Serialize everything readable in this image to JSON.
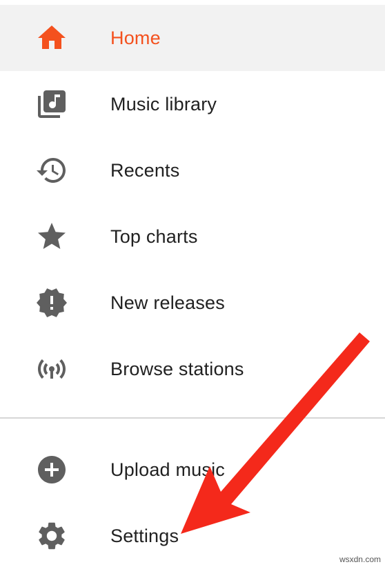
{
  "colors": {
    "accent": "#f4511e",
    "icon": "#5f5f5f",
    "text": "#212121",
    "active_background": "#f2f2f2",
    "annotation_arrow": "#f4291b"
  },
  "nav": {
    "items": [
      {
        "label": "Home",
        "icon": "home-icon",
        "active": true
      },
      {
        "label": "Music library",
        "icon": "music-library-icon"
      },
      {
        "label": "Recents",
        "icon": "recents-history-icon"
      },
      {
        "label": "Top charts",
        "icon": "star-icon"
      },
      {
        "label": "New releases",
        "icon": "new-releases-icon"
      },
      {
        "label": "Browse stations",
        "icon": "radio-stations-icon"
      }
    ],
    "secondary": [
      {
        "label": "Upload music",
        "icon": "add-circle-icon"
      },
      {
        "label": "Settings",
        "icon": "gear-icon"
      }
    ]
  },
  "watermark": "wsxdn.com"
}
